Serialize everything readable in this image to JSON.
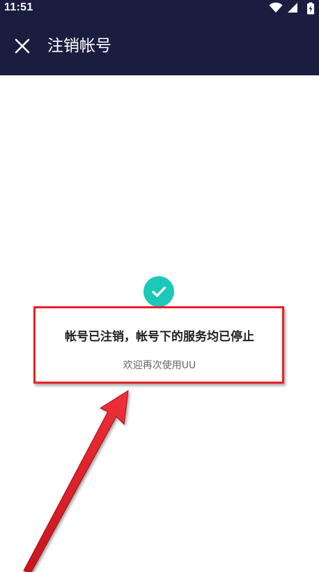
{
  "status_bar": {
    "time": "11:51",
    "icons": [
      "wifi-icon",
      "signal-icon",
      "battery-icon"
    ]
  },
  "app_bar": {
    "close_icon": "close-icon",
    "title": "注销帐号",
    "background": "#1a1d40"
  },
  "result": {
    "icon": "check-circle-icon",
    "icon_color": "#1cc8b7",
    "title": "帐号已注销，帐号下的服务均已停止",
    "subtitle": "欢迎再次使用UU"
  },
  "annotation": {
    "highlight_color": "#e8202a"
  }
}
